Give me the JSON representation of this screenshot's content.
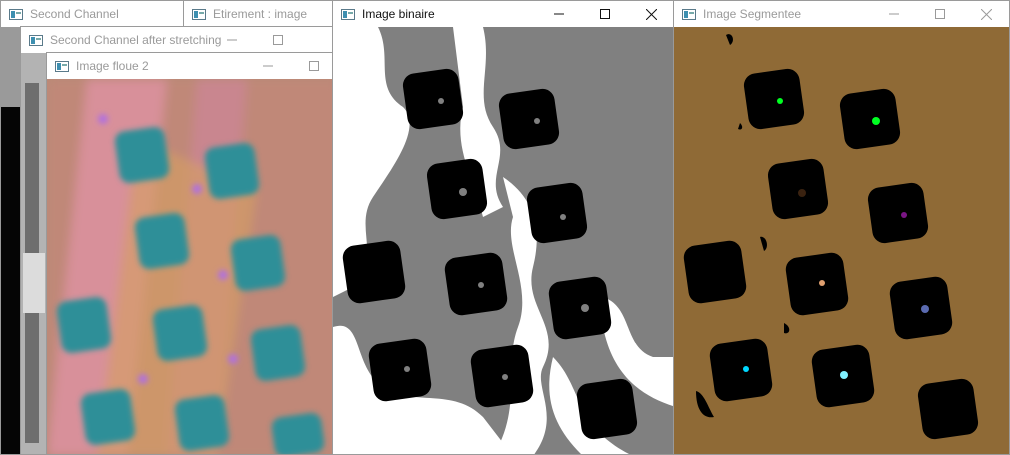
{
  "windows": {
    "second_channel": {
      "title": "Second Channel"
    },
    "etirement": {
      "title": "Etirement : image"
    },
    "after_stretching": {
      "title": "Second Channel after stretching"
    },
    "image_floue": {
      "title": "Image floue 2"
    },
    "image_binaire": {
      "title": "Image binaire"
    },
    "image_segmentee": {
      "title": "Image Segmentee"
    }
  },
  "icons": {
    "app": "opencv-window-icon",
    "minimize": "minimize-icon",
    "maximize": "maximize-icon",
    "close": "close-icon"
  },
  "colors": {
    "segmented_background": "#8f6a36",
    "binary_gray": "#808080",
    "blob_markers": [
      "#00ff22",
      "#00ff22",
      "#3a2210",
      "#7a1585",
      "#e0a070",
      "#5a6ab0",
      "#00d8ff",
      "#80f0ff"
    ]
  }
}
